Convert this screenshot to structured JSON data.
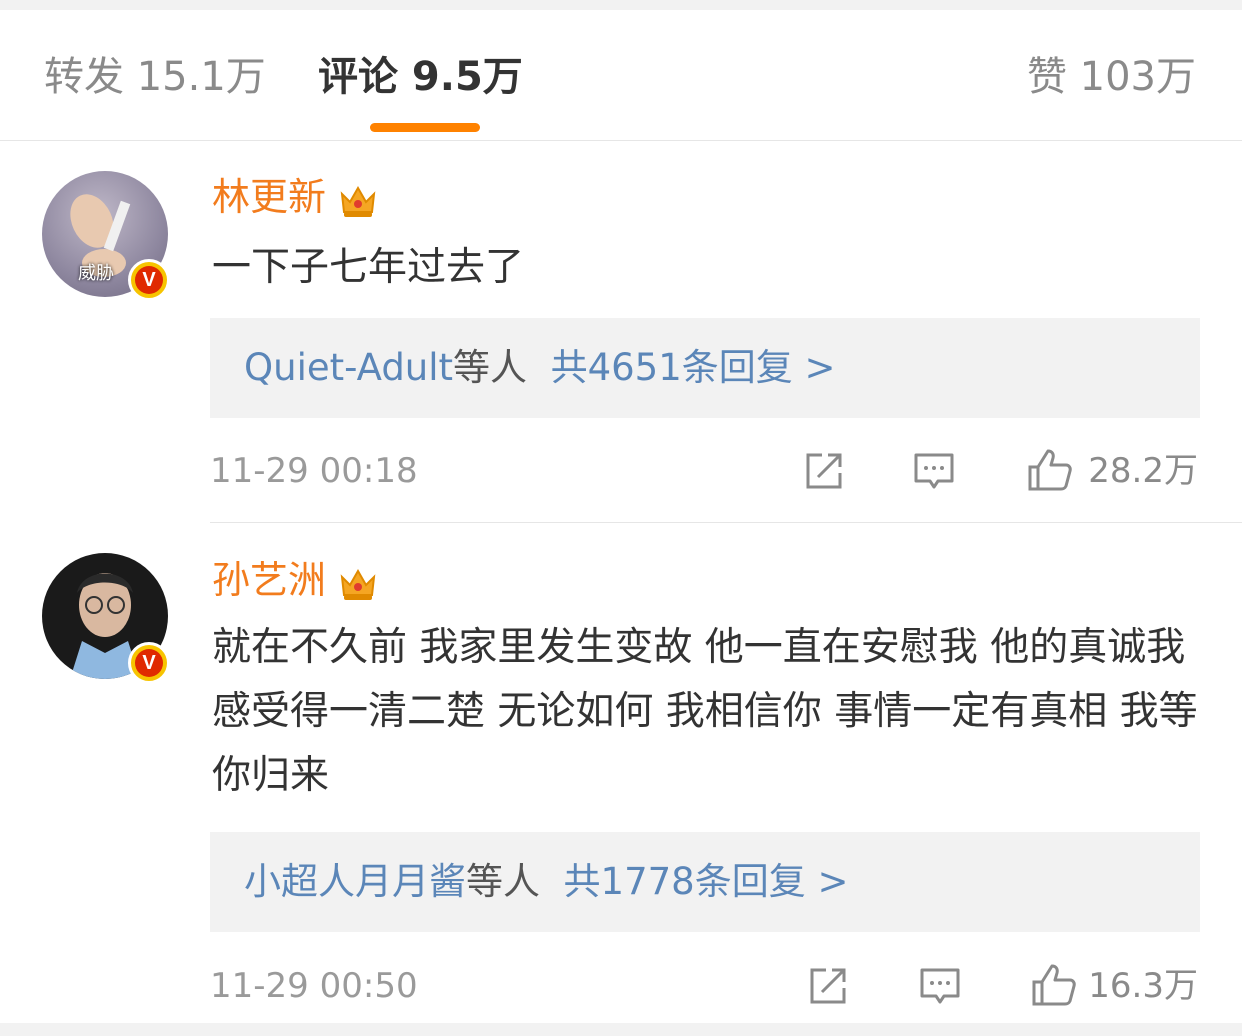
{
  "tabs": {
    "repost_label": "转发 15.1万",
    "comment_label": "评论 9.5万",
    "like_label": "赞 103万"
  },
  "colors": {
    "accent": "#ff8200",
    "username": "#f27c1d",
    "link": "#5b86b8"
  },
  "comments": [
    {
      "username": "林更新",
      "avatar_caption": "威胁",
      "verified_badge": "V",
      "text": "一下子七年过去了",
      "replies_users": "Quiet-Adult",
      "replies_suffix": "等人",
      "replies_count": "共4651条回复 >",
      "time": "11-29 00:18",
      "likes": "28.2万"
    },
    {
      "username": "孙艺洲",
      "verified_badge": "V",
      "text": "就在不久前 我家里发生变故 他一直在安慰我 他的真诚我感受得一清二楚 无论如何 我相信你 事情一定有真相 我等你归来",
      "replies_users": "小超人月月酱",
      "replies_suffix": "等人",
      "replies_count": "共1778条回复 >",
      "time": "11-29 00:50",
      "likes": "16.3万"
    }
  ],
  "icons": [
    "share-icon",
    "comment-icon",
    "thumbs-up-icon",
    "crown-icon",
    "verified-icon"
  ]
}
